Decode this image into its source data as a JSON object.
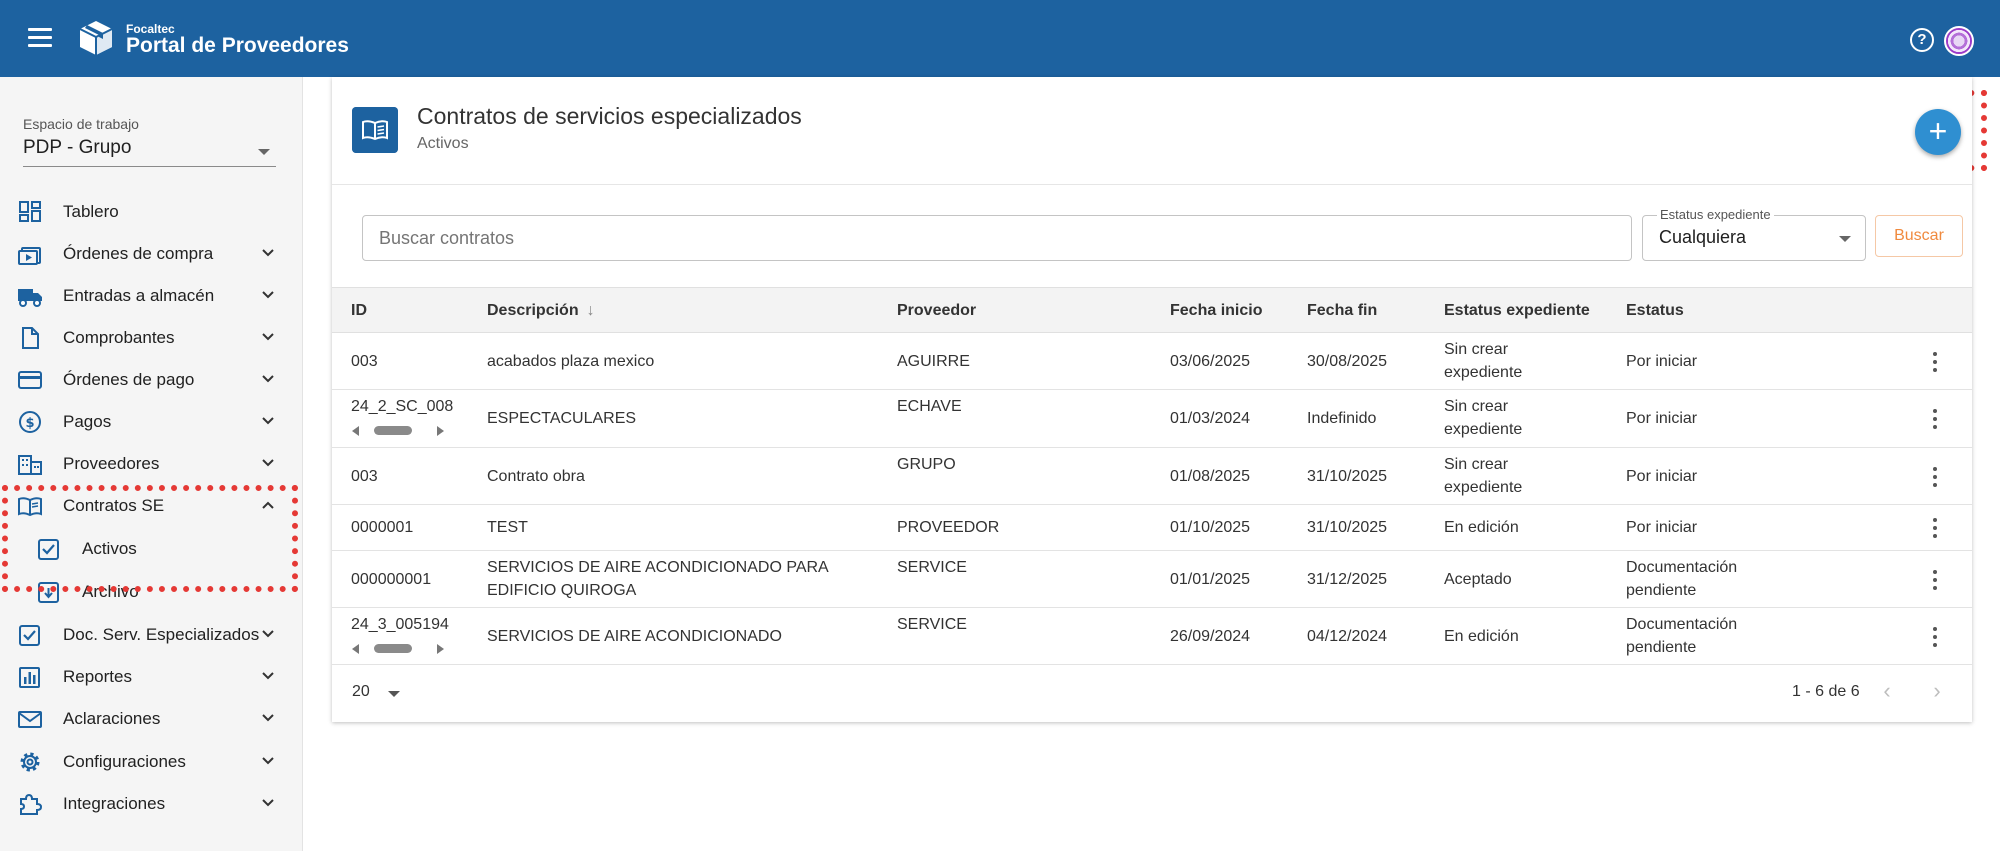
{
  "header": {
    "brand_small": "Focaltec",
    "brand_title": "Portal de Proveedores",
    "icons": [
      "menu-icon",
      "box-logo-icon",
      "help-icon",
      "avatar"
    ]
  },
  "sidebar": {
    "workspace_label": "Espacio de trabajo",
    "workspace_value": "PDP - Grupo",
    "items": [
      {
        "label": "Tablero",
        "icon": "dashboard-icon"
      },
      {
        "label": "Órdenes de compra",
        "icon": "purchase-order-icon"
      },
      {
        "label": "Entradas a almacén",
        "icon": "truck-icon"
      },
      {
        "label": "Comprobantes",
        "icon": "document-icon"
      },
      {
        "label": "Órdenes de pago",
        "icon": "credit-card-icon"
      },
      {
        "label": "Pagos",
        "icon": "dollar-icon"
      },
      {
        "label": "Proveedores",
        "icon": "building-icon"
      },
      {
        "label": "Contratos SE",
        "icon": "book-icon"
      },
      {
        "label": "Activos",
        "icon": "checkbox-icon"
      },
      {
        "label": "Archivo",
        "icon": "archive-icon"
      },
      {
        "label": "Doc. Serv. Especializados",
        "icon": "checkbox-icon"
      },
      {
        "label": "Reportes",
        "icon": "chart-icon"
      },
      {
        "label": "Aclaraciones",
        "icon": "mail-icon"
      },
      {
        "label": "Configuraciones",
        "icon": "gear-icon"
      },
      {
        "label": "Integraciones",
        "icon": "puzzle-icon"
      }
    ]
  },
  "main": {
    "title": "Contratos de servicios especializados",
    "subtitle": "Activos",
    "add_button": "+",
    "search_placeholder": "Buscar contratos",
    "status_filter_label": "Estatus expediente",
    "status_filter_value": "Cualquiera",
    "search_button": "Buscar",
    "columns": [
      "ID",
      "Descripción",
      "Proveedor",
      "Fecha inicio",
      "Fecha fin",
      "Estatus expediente",
      "Estatus"
    ],
    "rows": [
      {
        "id": "003",
        "descripcion": "acabados plaza mexico",
        "proveedor": "AGUIRRE",
        "fecha_inicio": "03/06/2025",
        "fecha_fin": "30/08/2025",
        "estatus_expediente": "Sin crear expediente",
        "estatus": "Por iniciar"
      },
      {
        "id": "24_2_SC_008",
        "descripcion": "ESPECTACULARES",
        "proveedor": "ECHAVE",
        "fecha_inicio": "01/03/2024",
        "fecha_fin": "Indefinido",
        "estatus_expediente": "Sin crear expediente",
        "estatus": "Por iniciar"
      },
      {
        "id": "003",
        "descripcion": "Contrato obra",
        "proveedor": "GRUPO",
        "fecha_inicio": "01/08/2025",
        "fecha_fin": "31/10/2025",
        "estatus_expediente": "Sin crear expediente",
        "estatus": "Por iniciar"
      },
      {
        "id": "0000001",
        "descripcion": "TEST",
        "proveedor": "PROVEEDOR",
        "fecha_inicio": "01/10/2025",
        "fecha_fin": "31/10/2025",
        "estatus_expediente": "En edición",
        "estatus": "Por iniciar"
      },
      {
        "id": "000000001",
        "descripcion": "SERVICIOS DE AIRE ACONDICIONADO PARA EDIFICIO QUIROGA",
        "proveedor": "SERVICE",
        "fecha_inicio": "01/01/2025",
        "fecha_fin": "31/12/2025",
        "estatus_expediente": "Aceptado",
        "estatus": "Documentación pendiente"
      },
      {
        "id": "24_3_005194",
        "descripcion": "SERVICIOS DE AIRE ACONDICIONADO",
        "proveedor": "SERVICE",
        "fecha_inicio": "26/09/2024",
        "fecha_fin": "04/12/2024",
        "estatus_expediente": "En edición",
        "estatus": "Documentación pendiente"
      }
    ],
    "page_size": "20",
    "range_text": "1 - 6 de 6"
  },
  "colors": {
    "header": "#1d62a0",
    "fab": "#2f8fd1",
    "accent_button": "#f08a3e",
    "highlight": "#e53935"
  }
}
